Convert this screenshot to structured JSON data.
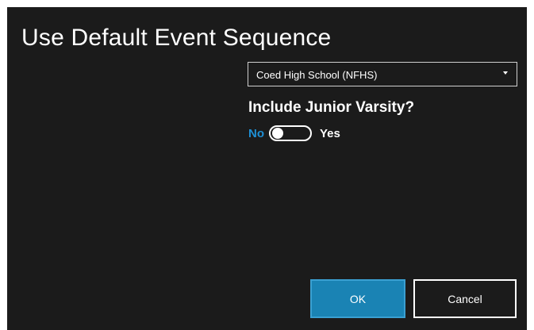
{
  "dialog": {
    "title": "Use Default Event Sequence",
    "sequence_select": {
      "value": "Coed High School (NFHS)"
    },
    "junior_varsity": {
      "heading": "Include Junior Varsity?",
      "off_label": "No",
      "on_label": "Yes",
      "state": "off"
    },
    "buttons": {
      "ok_label": "OK",
      "cancel_label": "Cancel"
    }
  },
  "colors": {
    "background": "#1b1b1b",
    "accent": "#1a83b4",
    "active_toggle_label": "#1e8fd4",
    "text": "#ffffff"
  }
}
